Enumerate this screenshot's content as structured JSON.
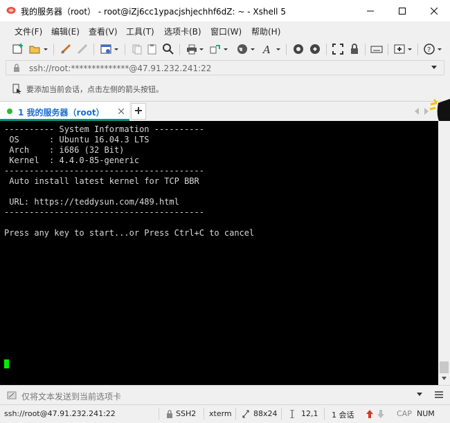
{
  "window": {
    "title": "我的服务器（root） - root@iZj6cc1ypacjshjechhf6dZ: ~ - Xshell 5"
  },
  "menu": [
    {
      "label": "文件(F)"
    },
    {
      "label": "编辑(E)"
    },
    {
      "label": "查看(V)"
    },
    {
      "label": "工具(T)"
    },
    {
      "label": "选项卡(B)"
    },
    {
      "label": "窗口(W)"
    },
    {
      "label": "帮助(H)"
    }
  ],
  "address_bar": {
    "value": "ssh://root:**************@47.91.232.241:22"
  },
  "hint": {
    "text": "要添加当前会话，点击左侧的箭头按钮。"
  },
  "tabs": [
    {
      "label": "1 我的服务器（root）",
      "active": true
    }
  ],
  "terminal": {
    "lines": [
      "---------- System Information ----------",
      " OS      : Ubuntu 16.04.3 LTS",
      " Arch    : i686 (32 Bit)",
      " Kernel  : 4.4.0-85-generic",
      "----------------------------------------",
      " Auto install latest kernel for TCP BBR",
      "",
      " URL: https://teddysun.com/489.html",
      "----------------------------------------",
      "",
      "Press any key to start...or Press Ctrl+C to cancel"
    ],
    "cursor_color": "#00ee00"
  },
  "compose_bar": {
    "placeholder": "仅将文本发送到当前选项卡"
  },
  "status_bar": {
    "connection": "ssh://root@47.91.232.241:22",
    "protocol": "SSH2",
    "terminal_type": "xterm",
    "size": "88x24",
    "cursor_pos": "12,1",
    "sessions": "1 会话",
    "cap": "CAP",
    "num": "NUM"
  },
  "colors": {
    "tab_accent": "#009688",
    "tab_text": "#1a6fd1",
    "terminal_bg": "#000000"
  }
}
